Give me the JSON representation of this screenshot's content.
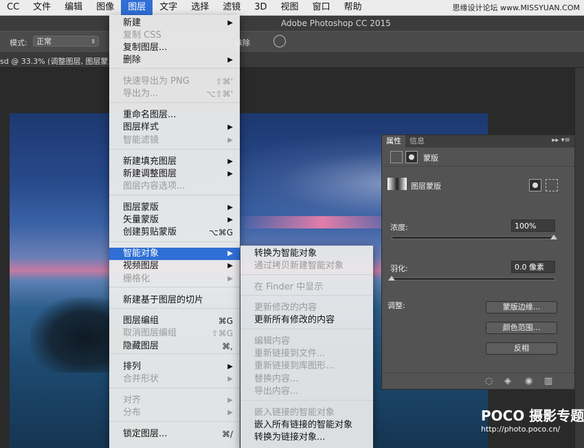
{
  "menubar": {
    "items": [
      "CC",
      "文件",
      "编辑",
      "图像",
      "图层",
      "文字",
      "选择",
      "滤镜",
      "3D",
      "视图",
      "窗口",
      "帮助"
    ],
    "active": "图层",
    "right_text": "思缘设计论坛 www.MISSYUAN.COM"
  },
  "titlebar": {
    "title": "Adobe Photoshop CC 2015"
  },
  "options": {
    "mode_label": "模式:",
    "mode_value": "正常",
    "erase_label": "抹除"
  },
  "doc_tab": {
    "title": "sd @ 33.3% (调整图层, 图层蒙"
  },
  "layer_menu": {
    "items": [
      {
        "label": "新建",
        "shortcut": "",
        "submenu": true,
        "disabled": false
      },
      {
        "label": "复制 CSS",
        "shortcut": "",
        "submenu": false,
        "disabled": true
      },
      {
        "label": "复制图层...",
        "shortcut": "",
        "submenu": false,
        "disabled": false
      },
      {
        "label": "删除",
        "shortcut": "",
        "submenu": true,
        "disabled": false
      },
      {
        "label": "快速导出为 PNG",
        "shortcut": "⇧⌘'",
        "submenu": false,
        "disabled": true
      },
      {
        "label": "导出为...",
        "shortcut": "⌥⇧⌘'",
        "submenu": false,
        "disabled": true
      },
      {
        "label": "重命名图层...",
        "shortcut": "",
        "submenu": false,
        "disabled": false
      },
      {
        "label": "图层样式",
        "shortcut": "",
        "submenu": true,
        "disabled": false
      },
      {
        "label": "智能滤镜",
        "shortcut": "",
        "submenu": true,
        "disabled": true
      },
      {
        "label": "新建填充图层",
        "shortcut": "",
        "submenu": true,
        "disabled": false
      },
      {
        "label": "新建调整图层",
        "shortcut": "",
        "submenu": true,
        "disabled": false
      },
      {
        "label": "图层内容选项...",
        "shortcut": "",
        "submenu": false,
        "disabled": true
      },
      {
        "label": "图层蒙版",
        "shortcut": "",
        "submenu": true,
        "disabled": false
      },
      {
        "label": "矢量蒙版",
        "shortcut": "",
        "submenu": true,
        "disabled": false
      },
      {
        "label": "创建剪贴蒙版",
        "shortcut": "⌥⌘G",
        "submenu": false,
        "disabled": false
      },
      {
        "label": "智能对象",
        "shortcut": "",
        "submenu": true,
        "disabled": false,
        "highlighted": true
      },
      {
        "label": "视频图层",
        "shortcut": "",
        "submenu": true,
        "disabled": false
      },
      {
        "label": "栅格化",
        "shortcut": "",
        "submenu": true,
        "disabled": true
      },
      {
        "label": "新建基于图层的切片",
        "shortcut": "",
        "submenu": false,
        "disabled": false
      },
      {
        "label": "图层编组",
        "shortcut": "⌘G",
        "submenu": false,
        "disabled": false
      },
      {
        "label": "取消图层编组",
        "shortcut": "⇧⌘G",
        "submenu": false,
        "disabled": true
      },
      {
        "label": "隐藏图层",
        "shortcut": "⌘,",
        "submenu": false,
        "disabled": false
      },
      {
        "label": "排列",
        "shortcut": "",
        "submenu": true,
        "disabled": false
      },
      {
        "label": "合并形状",
        "shortcut": "",
        "submenu": true,
        "disabled": true
      },
      {
        "label": "对齐",
        "shortcut": "",
        "submenu": true,
        "disabled": true
      },
      {
        "label": "分布",
        "shortcut": "",
        "submenu": true,
        "disabled": true
      },
      {
        "label": "锁定图层...",
        "shortcut": "⌘/",
        "submenu": false,
        "disabled": false
      }
    ]
  },
  "smart_object_menu": {
    "items": [
      {
        "label": "转换为智能对象",
        "disabled": false
      },
      {
        "label": "通过拷贝新建智能对象",
        "disabled": true
      },
      {
        "label": "在 Finder 中显示",
        "disabled": true
      },
      {
        "label": "更新修改的内容",
        "disabled": true
      },
      {
        "label": "更新所有修改的内容",
        "disabled": false
      },
      {
        "label": "编辑内容",
        "disabled": true
      },
      {
        "label": "重新链接到文件...",
        "disabled": true
      },
      {
        "label": "重新链接到库图形...",
        "disabled": true
      },
      {
        "label": "替换内容...",
        "disabled": true
      },
      {
        "label": "导出内容...",
        "disabled": true
      },
      {
        "label": "嵌入链接的智能对象",
        "disabled": true
      },
      {
        "label": "嵌入所有链接的智能对象",
        "disabled": false
      },
      {
        "label": "转换为链接对象...",
        "disabled": false
      }
    ]
  },
  "properties": {
    "tab_active": "属性",
    "tab_other": "信息",
    "tab_icons": "▸▸ ▾≡",
    "mask_label": "蒙版",
    "layer_mask_label": "图层蒙版",
    "density_label": "浓度:",
    "density_value": "100%",
    "density_level": 1.0,
    "feather_label": "羽化:",
    "feather_value": "0.0 像素",
    "feather_level": 0.0,
    "adjust_label": "调整:",
    "btn_mask_edge": "蒙版边缘...",
    "btn_color_range": "颜色范围...",
    "btn_invert": "反相"
  },
  "watermark": {
    "brand": "POCO 摄影专题",
    "url": "http://photo.poco.cn/"
  }
}
